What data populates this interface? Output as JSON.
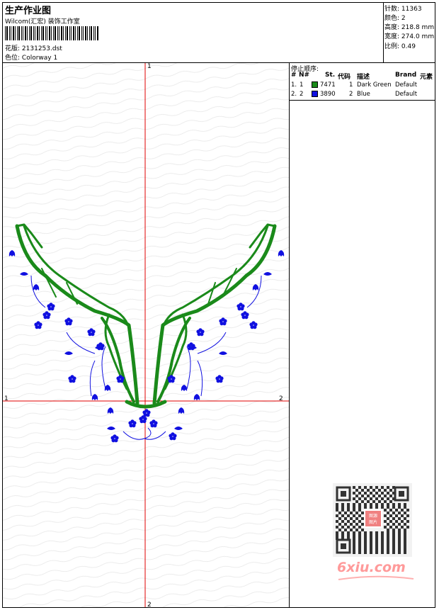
{
  "header": {
    "title": "生产作业图",
    "subtitle": "Wilcom(汇宏) 装饰工作室",
    "design": {
      "label": "花版:",
      "value": "2131253.dst"
    },
    "colorway": {
      "label": "色位:",
      "value": "Colorway 1"
    }
  },
  "stats": [
    {
      "label": "针数:",
      "value": "11363"
    },
    {
      "label": "颜色:",
      "value": "2"
    },
    {
      "label": "高度:",
      "value": "218.8 mm"
    },
    {
      "label": "宽度:",
      "value": "274.0 mm"
    },
    {
      "label": "比例:",
      "value": "0.49"
    }
  ],
  "axis_labels": {
    "top": "1",
    "bottom": "2",
    "left": "1",
    "right": "2"
  },
  "stop_sequence": {
    "title": "停止顺序:",
    "columns": {
      "hash": "#",
      "n": "N#",
      "st": "St.",
      "code": "代码",
      "desc": "描述",
      "brand": "Brand",
      "element": "元素"
    },
    "rows": [
      {
        "hash": "1.",
        "n": "1",
        "color": "#1a8a1a",
        "st": "7471",
        "code": "1",
        "desc": "Dark Green",
        "brand": "Default"
      },
      {
        "hash": "2.",
        "n": "2",
        "color": "#1010e0",
        "st": "3890",
        "code": "2",
        "desc": "Blue",
        "brand": "Default"
      }
    ]
  },
  "colors": {
    "green": "#1a8a1a",
    "blue": "#1010e0",
    "axis": "#e00000"
  },
  "watermark": {
    "text": "6xiu.com",
    "qr_center": "图源图片"
  }
}
